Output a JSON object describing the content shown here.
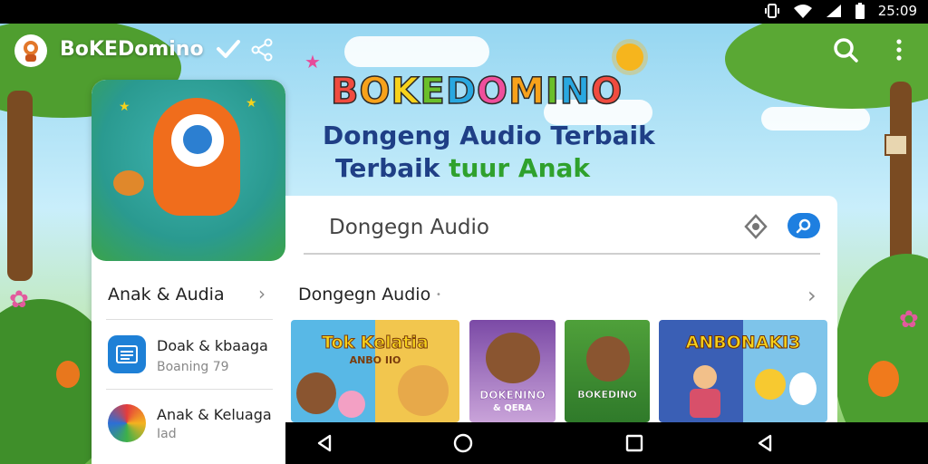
{
  "status_bar": {
    "time": "25:09",
    "icons": [
      "vibrate-icon",
      "wifi-icon",
      "signal-icon",
      "battery-icon"
    ]
  },
  "app_bar": {
    "title": "BoKEDomino",
    "icons": [
      "app-logo-icon",
      "check-icon",
      "share-icon",
      "search-icon",
      "more-vert-icon"
    ]
  },
  "hero": {
    "brand_letters": [
      "B",
      "O",
      "K",
      "E",
      "D",
      "O",
      "M",
      "I",
      "N",
      "O"
    ],
    "brand_colors": [
      "#f04b3f",
      "#f7a21b",
      "#f7d21b",
      "#6abf2a",
      "#29a8e0",
      "#ef4f9c",
      "#f7a21b",
      "#6abf2a",
      "#29a8e0",
      "#f04b3f"
    ],
    "line1": "Dongeng Audio Terbaik",
    "line2_part1": "Terbaik",
    "line2_part2": "tuur Anak"
  },
  "left_panel": {
    "header": "Anak & Audia",
    "items": [
      {
        "title": "Doak & kbaaga",
        "subtitle": "Boaning 79",
        "icon": "book-list-icon"
      },
      {
        "title": "Anak & Keluaga",
        "subtitle": "Iad",
        "icon": "colorful-globe-icon"
      }
    ]
  },
  "main": {
    "search_value": "Dongegn Audio",
    "search_actions": [
      "filter-icon",
      "search-icon"
    ],
    "section_title": "Dongegn Audio",
    "books": [
      {
        "title": "Tok Kelatia",
        "subtitle": "ANBO IIO"
      },
      {
        "title": "DOKENINO",
        "subtitle": "& QERA"
      },
      {
        "title": "BOKEDINO",
        "subtitle": ""
      },
      {
        "title": "ANBONAKI3",
        "subtitle": ""
      }
    ]
  },
  "nav_bar": {
    "buttons": [
      "back-icon",
      "home-icon",
      "recents-icon",
      "back-icon"
    ]
  },
  "colors": {
    "accent_blue": "#1e7fe0",
    "mascot_orange": "#f06d1c",
    "title_navy": "#1f3f86",
    "title_green": "#2fa12d"
  }
}
